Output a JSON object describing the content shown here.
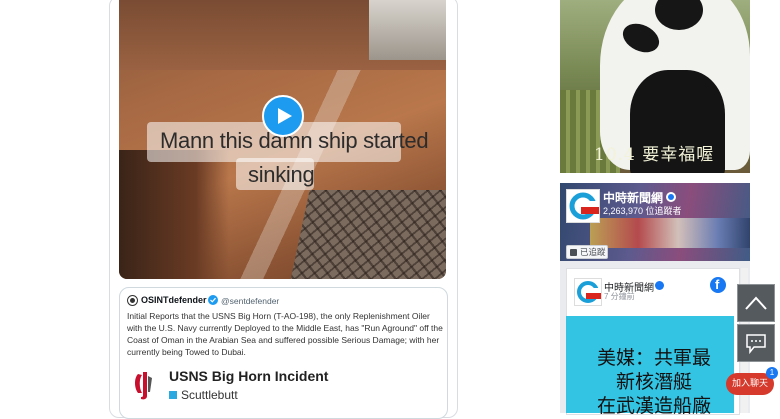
{
  "video": {
    "caption_line1": "Mann this damn ship started",
    "caption_line2": "sinking"
  },
  "quoted_tweet": {
    "name": "OSINTdefender",
    "handle": "@sentdefender",
    "text": "Initial Reports that the USNS Big Horn (T-AO-198), the only Replenishment Oiler with the U.S. Navy currently Deployed to the Middle East, has \"Run Aground\" off the Coast of Oman in the Arabian Sea and suffered possible Serious Damage; with her currently being Towed to Dubai.",
    "link_title": "USNS Big Horn Incident",
    "link_site": "Scuttlebutt"
  },
  "ad": {
    "text": "10.4 要幸福喔"
  },
  "facebook_widget": {
    "page_name": "中時新聞網",
    "fans": "2,263,970 位追蹤者",
    "follow_label": "已追蹤",
    "post": {
      "author": "中時新聞網",
      "time": "7 分鐘前",
      "headline_line1": "美媒：共軍最",
      "headline_line2": "新核潛艇",
      "headline_line3": "在武漢造船廠"
    }
  },
  "floating": {
    "join_chat": "加入聊天",
    "badge": "1"
  }
}
